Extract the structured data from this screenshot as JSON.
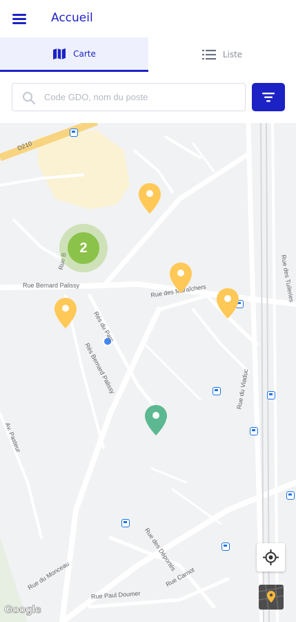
{
  "header": {
    "title": "Accueil",
    "menu_icon": "hamburger-menu-icon"
  },
  "tabs": [
    {
      "label": "Carte",
      "icon": "map-icon",
      "active": true
    },
    {
      "label": "Liste",
      "icon": "list-icon",
      "active": false
    }
  ],
  "search": {
    "placeholder": "Code GDO, nom du poste",
    "value": ""
  },
  "filter": {
    "icon": "filter-icon"
  },
  "map": {
    "cluster_count": "2",
    "streets": {
      "d210": "D210",
      "rue_bernard_palissy": "Rue Bernard Palissy",
      "rue_b": "Rue B",
      "rue_des_maraichers": "Rue des Maraîchers",
      "res_du_parc": "Rés du Parc",
      "res_bernard_palissy": "Rés Bernard Palissy",
      "av_pasteur": "Av. Pasteur",
      "rue_du_viaduc": "Rue du Viaduc",
      "rue_des_tuileries": "Rue des Tuileries",
      "rue_des_deportes": "Rue des Déportés",
      "rue_du_monceau": "Rue du Monceau",
      "rue_paul_doumer": "Rue Paul Doumer",
      "rue_carnot": "Rue Carnot"
    },
    "attribution": "Google",
    "locate_icon": "my-location-icon",
    "layer_icon": "map-layer-icon"
  },
  "colors": {
    "primary": "#1d22c4",
    "pin_yellow": "#ffc857",
    "pin_green": "#5cb890",
    "cluster": "#8bc34a",
    "map_bg": "#f1f2f3"
  }
}
